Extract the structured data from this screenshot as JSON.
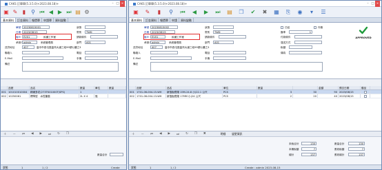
{
  "windows": [
    {
      "title": "CAKS 訂單單(5.3.5.0)+2023.08.18)+",
      "tabs": [
        "基本資料",
        "訂金資料",
        "報價單",
        "申請單",
        "資料變動",
        "資料變動"
      ],
      "form": {
        "order_no_label": "單號",
        "order_no": "20230815001",
        "status_label": "狀態",
        "status": "",
        "date_label": "日期",
        "date": "2023/08/15",
        "customer_label": "客戶",
        "customer_code": "EV01",
        "customer_name": "民國工作室",
        "currency_label": "幣別",
        "currency": "TWD",
        "billing_label": "請款條件",
        "billing": "",
        "sales_label": "承辦人",
        "sales_code": "admin",
        "sales_name": "系統管理員",
        "dept_label": "部門",
        "dept": "A01",
        "addr_label": "送貨地址",
        "zip": "407",
        "address": "臺中市西屯區臺灣大道三段99號七樓之3",
        "contact_label": "聯絡人",
        "contact": "",
        "tel_label": "電話",
        "tel": "",
        "email_label": "E-Mail",
        "email": "",
        "mobile_label": "手機",
        "mobile": "",
        "note_label": "備註",
        "note": ""
      },
      "grid": {
        "headers": [
          "",
          "品號",
          "品名",
          "數量",
          "單位",
          "數量"
        ],
        "rows": [
          {
            "no": "001",
            "item": "101010010004",
            "name": "精緻多花(273TK01000T/SPS)",
            "qty": "1",
            "unit": "",
            "qty2": ""
          },
          {
            "no": "002",
            "item": "10250061",
            "name": "標準型　水性筆墨",
            "qty": "2L X 4",
            "unit": "瓶",
            "qty2": ""
          }
        ]
      },
      "bottom": {
        "total_label": "數量合計",
        "total": ""
      },
      "status": {
        "record": "1",
        "of": "1 / 2",
        "create": "Create"
      }
    },
    {
      "title": "CAKS 訂單單(5.3.5.0)+2023.08.18)+",
      "tabs": [
        "基本資料",
        "訂金資料",
        "報價單",
        "申請",
        "資料變動"
      ],
      "form": {
        "order_no_label": "單號",
        "order_no": "20230815002",
        "status_label": "狀態",
        "status": "",
        "date_label": "日期",
        "date": "2023/08/15",
        "customer_label": "客戶",
        "customer_code": "EV01",
        "customer_name": "民國工作室",
        "currency_label": "幣別",
        "currency": "TWD",
        "rate_label": "匯率",
        "rate": "1",
        "billing_label": "請款條件",
        "billing": "",
        "sales_label": "承辦人",
        "sales_code": "admin",
        "sales_name": "系統管理員",
        "dept_label": "部門",
        "dept": "A01",
        "addr_label": "送貨地址",
        "zip": "407",
        "address": "臺中市西屯區臺灣大道三段99號七樓之3",
        "contact_label": "聯絡人",
        "contact": "",
        "tel_label": "電話",
        "tel": "",
        "email_label": "E-Mail",
        "email": "",
        "mobile_label": "手機",
        "mobile": "",
        "fax_label": "傳真",
        "fax": "",
        "note_label": "備註",
        "note": "",
        "closed_label": "已結",
        "cancel_label": "作廢",
        "tax_label": "稅額",
        "tax": "",
        "payment_label": "付款條件",
        "payment": "",
        "dest_label": "運送方式",
        "dest": "",
        "approved_label": "APPROVED"
      },
      "grid": {
        "headers": [
          "",
          "品號",
          "品名",
          "單位",
          "數量",
          "",
          "金額",
          "預交日期",
          "贈品"
        ],
        "rows": [
          {
            "no": "001",
            "item": "1701-06-004-15-WH",
            "name": "新箔板鐵捲 15M-24.8 小(22.1 公尺",
            "unit": "PCS",
            "qty": "3",
            "price": "30",
            "amount": "90",
            "date": "2023/08/15"
          },
          {
            "no": "002",
            "item": "1701-06-004-13-WH",
            "name": "新箔板鐵捲 17MM 小(24 公尺",
            "unit": "PCS",
            "qty": "2",
            "price": "20",
            "amount": "40",
            "date": "2023/08/15"
          }
        ]
      },
      "subtabs": [
        "明細",
        "變更資訊"
      ],
      "bottom": {
        "sub_total_label": "未稅合計",
        "sub_total": "130",
        "this_tax_label": "本期稅額",
        "this_tax": "7",
        "total_label": "總計",
        "total": "137",
        "qty_total_label": "數量合計",
        "qty_total": "5",
        "contract_label": "總金額",
        "contract": "137",
        "ref_total_label": "數量合計",
        "ref_total": "130",
        "tax_amount_label": "應收稅額",
        "tax_amount": "7",
        "grand_label": "應收總計",
        "grand": "137"
      },
      "status": {
        "record": "1",
        "of": "1 / 2",
        "create": "Create : admin  2023-08-15"
      }
    }
  ],
  "colors": {
    "accent_red": "#e12b2b",
    "approved_green": "#1e9a3a",
    "grid_select": "#c9d8f0"
  }
}
